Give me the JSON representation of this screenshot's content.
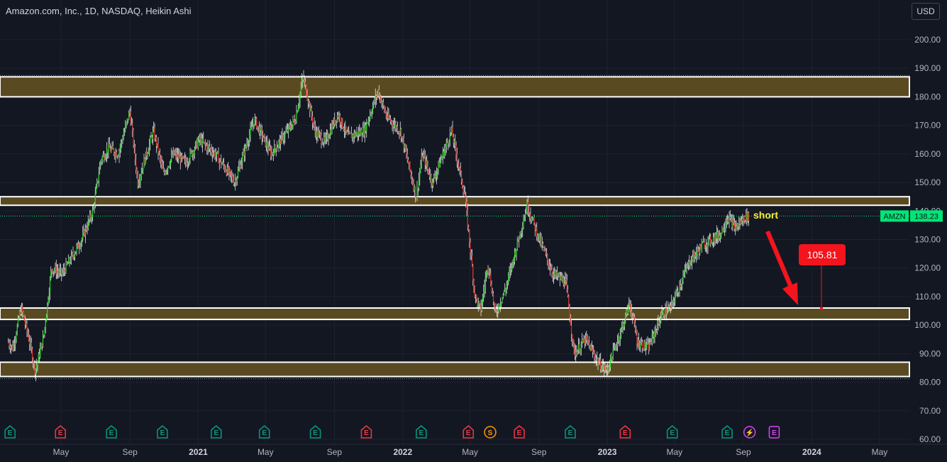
{
  "header": {
    "title": "Amazon.com, Inc., 1D, NASDAQ, Heikin Ashi",
    "currency": "USD"
  },
  "colors": {
    "background": "#131722",
    "up": "#26d926",
    "down": "#e0302a",
    "wick": "#ffffff",
    "zone_fill": "#5a4a22",
    "zone_border": "#ffffff",
    "last_price": "#00e676",
    "target": "#f3141d",
    "annotation": "#ffeb3b"
  },
  "chart_data": {
    "type": "candlestick",
    "symbol": "AMZN",
    "exchange": "NASDAQ",
    "interval": "1D",
    "style": "Heikin Ashi",
    "ylim": [
      60,
      200
    ],
    "y_ticks": [
      "200.00",
      "190.00",
      "180.00",
      "170.00",
      "160.00",
      "150.00",
      "140.00",
      "130.00",
      "120.00",
      "110.00",
      "100.00",
      "90.00",
      "80.00",
      "70.00",
      "60.00"
    ],
    "x_ticks": [
      "May",
      "Sep",
      "2021",
      "May",
      "Sep",
      "2022",
      "May",
      "Sep",
      "2023",
      "May",
      "Sep",
      "2024",
      "May"
    ],
    "x_tick_dates": [
      "2020-05-01",
      "2020-09-01",
      "2021-01-01",
      "2021-05-01",
      "2021-09-01",
      "2022-01-01",
      "2022-05-01",
      "2022-09-01",
      "2023-01-01",
      "2023-05-01",
      "2023-09-01",
      "2024-01-01",
      "2024-05-01"
    ],
    "last_price": {
      "label": "AMZN",
      "value": "138.23"
    },
    "zones": [
      {
        "low": 180.0,
        "high": 187.0
      },
      {
        "low": 142.0,
        "high": 145.0
      },
      {
        "low": 102.0,
        "high": 106.0
      },
      {
        "low": 82.0,
        "high": 87.0
      }
    ],
    "close_path": [
      {
        "date": "2020-01-28",
        "close": 94
      },
      {
        "date": "2020-02-05",
        "close": 92
      },
      {
        "date": "2020-02-20",
        "close": 106
      },
      {
        "date": "2020-03-05",
        "close": 95
      },
      {
        "date": "2020-03-16",
        "close": 84
      },
      {
        "date": "2020-03-31",
        "close": 96
      },
      {
        "date": "2020-04-14",
        "close": 120
      },
      {
        "date": "2020-05-03",
        "close": 118
      },
      {
        "date": "2020-06-07",
        "close": 130
      },
      {
        "date": "2020-06-27",
        "close": 140
      },
      {
        "date": "2020-07-11",
        "close": 158
      },
      {
        "date": "2020-07-25",
        "close": 162
      },
      {
        "date": "2020-08-11",
        "close": 160
      },
      {
        "date": "2020-09-01",
        "close": 175
      },
      {
        "date": "2020-09-15",
        "close": 150
      },
      {
        "date": "2020-10-13",
        "close": 168
      },
      {
        "date": "2020-10-31",
        "close": 153
      },
      {
        "date": "2020-11-18",
        "close": 160
      },
      {
        "date": "2020-12-10",
        "close": 157
      },
      {
        "date": "2021-01-03",
        "close": 165
      },
      {
        "date": "2021-01-31",
        "close": 160
      },
      {
        "date": "2021-02-18",
        "close": 155
      },
      {
        "date": "2021-03-07",
        "close": 150
      },
      {
        "date": "2021-04-11",
        "close": 172
      },
      {
        "date": "2021-05-11",
        "close": 160
      },
      {
        "date": "2021-06-23",
        "close": 172
      },
      {
        "date": "2021-07-07",
        "close": 187
      },
      {
        "date": "2021-07-28",
        "close": 168
      },
      {
        "date": "2021-08-15",
        "close": 164
      },
      {
        "date": "2021-09-07",
        "close": 174
      },
      {
        "date": "2021-09-25",
        "close": 166
      },
      {
        "date": "2021-10-24",
        "close": 168
      },
      {
        "date": "2021-11-18",
        "close": 182
      },
      {
        "date": "2021-12-03",
        "close": 173
      },
      {
        "date": "2021-12-28",
        "close": 168
      },
      {
        "date": "2022-01-25",
        "close": 145
      },
      {
        "date": "2022-02-05",
        "close": 160
      },
      {
        "date": "2022-02-23",
        "close": 150
      },
      {
        "date": "2022-03-29",
        "close": 168
      },
      {
        "date": "2022-04-22",
        "close": 145
      },
      {
        "date": "2022-05-10",
        "close": 110
      },
      {
        "date": "2022-05-20",
        "close": 105
      },
      {
        "date": "2022-06-02",
        "close": 122
      },
      {
        "date": "2022-06-15",
        "close": 104
      },
      {
        "date": "2022-07-04",
        "close": 113
      },
      {
        "date": "2022-08-11",
        "close": 142
      },
      {
        "date": "2022-09-06",
        "close": 128
      },
      {
        "date": "2022-09-26",
        "close": 118
      },
      {
        "date": "2022-10-19",
        "close": 115
      },
      {
        "date": "2022-11-03",
        "close": 90
      },
      {
        "date": "2022-11-23",
        "close": 95
      },
      {
        "date": "2022-12-16",
        "close": 87
      },
      {
        "date": "2022-12-31",
        "close": 84
      },
      {
        "date": "2023-01-29",
        "close": 100
      },
      {
        "date": "2023-02-10",
        "close": 108
      },
      {
        "date": "2023-02-24",
        "close": 94
      },
      {
        "date": "2023-03-15",
        "close": 92
      },
      {
        "date": "2023-04-09",
        "close": 104
      },
      {
        "date": "2023-04-24",
        "close": 106
      },
      {
        "date": "2023-05-27",
        "close": 122
      },
      {
        "date": "2023-06-20",
        "close": 128
      },
      {
        "date": "2023-07-22",
        "close": 132
      },
      {
        "date": "2023-08-04",
        "close": 138
      },
      {
        "date": "2023-08-18",
        "close": 134
      },
      {
        "date": "2023-09-04",
        "close": 138
      },
      {
        "date": "2023-09-12",
        "close": 138
      }
    ],
    "annotations": {
      "short_label": "short",
      "target_label": "105.81",
      "target_value": 105.81
    },
    "events": [
      {
        "date": "2020-01-31",
        "type": "E",
        "color": "green"
      },
      {
        "date": "2020-04-30",
        "type": "E",
        "color": "red"
      },
      {
        "date": "2020-07-30",
        "type": "E",
        "color": "green"
      },
      {
        "date": "2020-10-29",
        "type": "E",
        "color": "green"
      },
      {
        "date": "2021-02-02",
        "type": "E",
        "color": "green"
      },
      {
        "date": "2021-04-29",
        "type": "E",
        "color": "green"
      },
      {
        "date": "2021-07-29",
        "type": "E",
        "color": "green"
      },
      {
        "date": "2021-10-28",
        "type": "E",
        "color": "red"
      },
      {
        "date": "2022-02-03",
        "type": "E",
        "color": "green"
      },
      {
        "date": "2022-04-28",
        "type": "E",
        "color": "red"
      },
      {
        "date": "2022-06-06",
        "type": "S",
        "color": "orange"
      },
      {
        "date": "2022-07-28",
        "type": "E",
        "color": "red"
      },
      {
        "date": "2022-10-27",
        "type": "E",
        "color": "green"
      },
      {
        "date": "2023-02-02",
        "type": "E",
        "color": "red"
      },
      {
        "date": "2023-04-27",
        "type": "E",
        "color": "green"
      },
      {
        "date": "2023-08-03",
        "type": "E",
        "color": "green"
      },
      {
        "date": "2023-09-12",
        "type": "bolt",
        "color": "purple"
      },
      {
        "date": "2023-10-26",
        "type": "E",
        "color": "purple"
      }
    ]
  }
}
